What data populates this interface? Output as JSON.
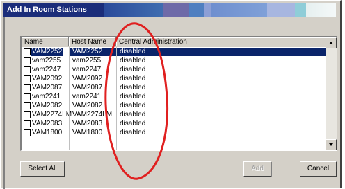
{
  "window": {
    "title": "Add In Room Stations"
  },
  "table": {
    "columns": [
      "Name",
      "Host Name",
      "Central Administration"
    ],
    "rows": [
      {
        "name": "VAM2252",
        "host": "VAM2252",
        "admin": "disabled",
        "selected": true
      },
      {
        "name": "vam2255",
        "host": "vam2255",
        "admin": "disabled"
      },
      {
        "name": "vam2247",
        "host": "vam2247",
        "admin": "disabled"
      },
      {
        "name": "VAM2092",
        "host": "VAM2092",
        "admin": "disabled"
      },
      {
        "name": "VAM2087",
        "host": "VAM2087",
        "admin": "disabled"
      },
      {
        "name": "vam2241",
        "host": "vam2241",
        "admin": "disabled"
      },
      {
        "name": "VAM2082",
        "host": "VAM2082",
        "admin": "disabled"
      },
      {
        "name": "VAM2274LM",
        "host": "VAM2274LM",
        "admin": "disabled"
      },
      {
        "name": "VAM2083",
        "host": "VAM2083",
        "admin": "disabled"
      },
      {
        "name": "VAM1800",
        "host": "VAM1800",
        "admin": "disabled"
      }
    ]
  },
  "buttons": {
    "select_all": "Select All",
    "add": "Add",
    "cancel": "Cancel"
  },
  "colors": {
    "selection": "#0a246a",
    "annotation": "#e02020"
  }
}
